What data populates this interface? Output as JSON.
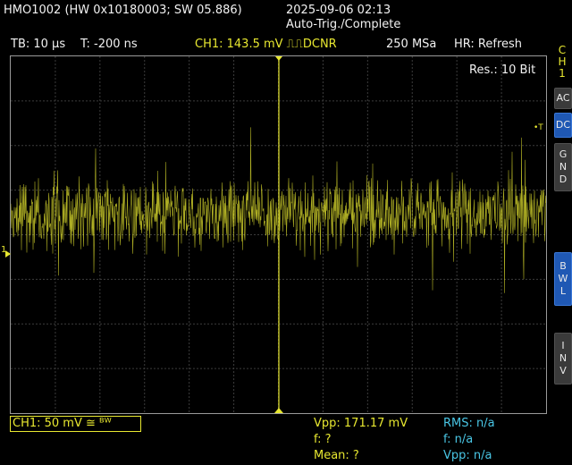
{
  "header": {
    "device_info": "HMO1002 (HW 0x10180003; SW 05.886)",
    "datetime": "2025-09-06 02:13",
    "status": "Auto-Trig./Complete"
  },
  "toolbar": {
    "timebase": "TB: 10 µs",
    "trigger_time": "T: -200 ns",
    "channel_trigger": "CH1: 143.5 mV ⎍⎍DCNR",
    "sample_rate": "250 MSa",
    "hr_mode": "HR: Refresh"
  },
  "screen": {
    "resolution": "Res.: 10 Bit",
    "trigger_marker": "•T",
    "ch1_marker": "1",
    "trace_color": "#e8e830",
    "grid_color": "#3c3c3c",
    "cursor_color": "#e8e830"
  },
  "side_panel": {
    "channel_letters": [
      "C",
      "H",
      "1"
    ],
    "buttons": [
      {
        "letters": [
          "AC"
        ],
        "active": false
      },
      {
        "letters": [
          "DC"
        ],
        "active": true
      },
      {
        "letters": [
          "G",
          "N",
          "D"
        ],
        "active": false
      },
      {
        "letters": [
          "B",
          "W",
          "L"
        ],
        "active": true
      },
      {
        "letters": [
          "I",
          "N",
          "V"
        ],
        "active": false
      }
    ]
  },
  "bottom": {
    "ch1_setting": "CH1: 50 mV ≅ ᴮᵂ",
    "vpp": "Vpp: 171.17 mV",
    "freq": "f: ?",
    "mean": "Mean: ?",
    "rms_right": "RMS: n/a",
    "freq_right": "f: n/a",
    "vpp_right": "Vpp: n/a"
  }
}
